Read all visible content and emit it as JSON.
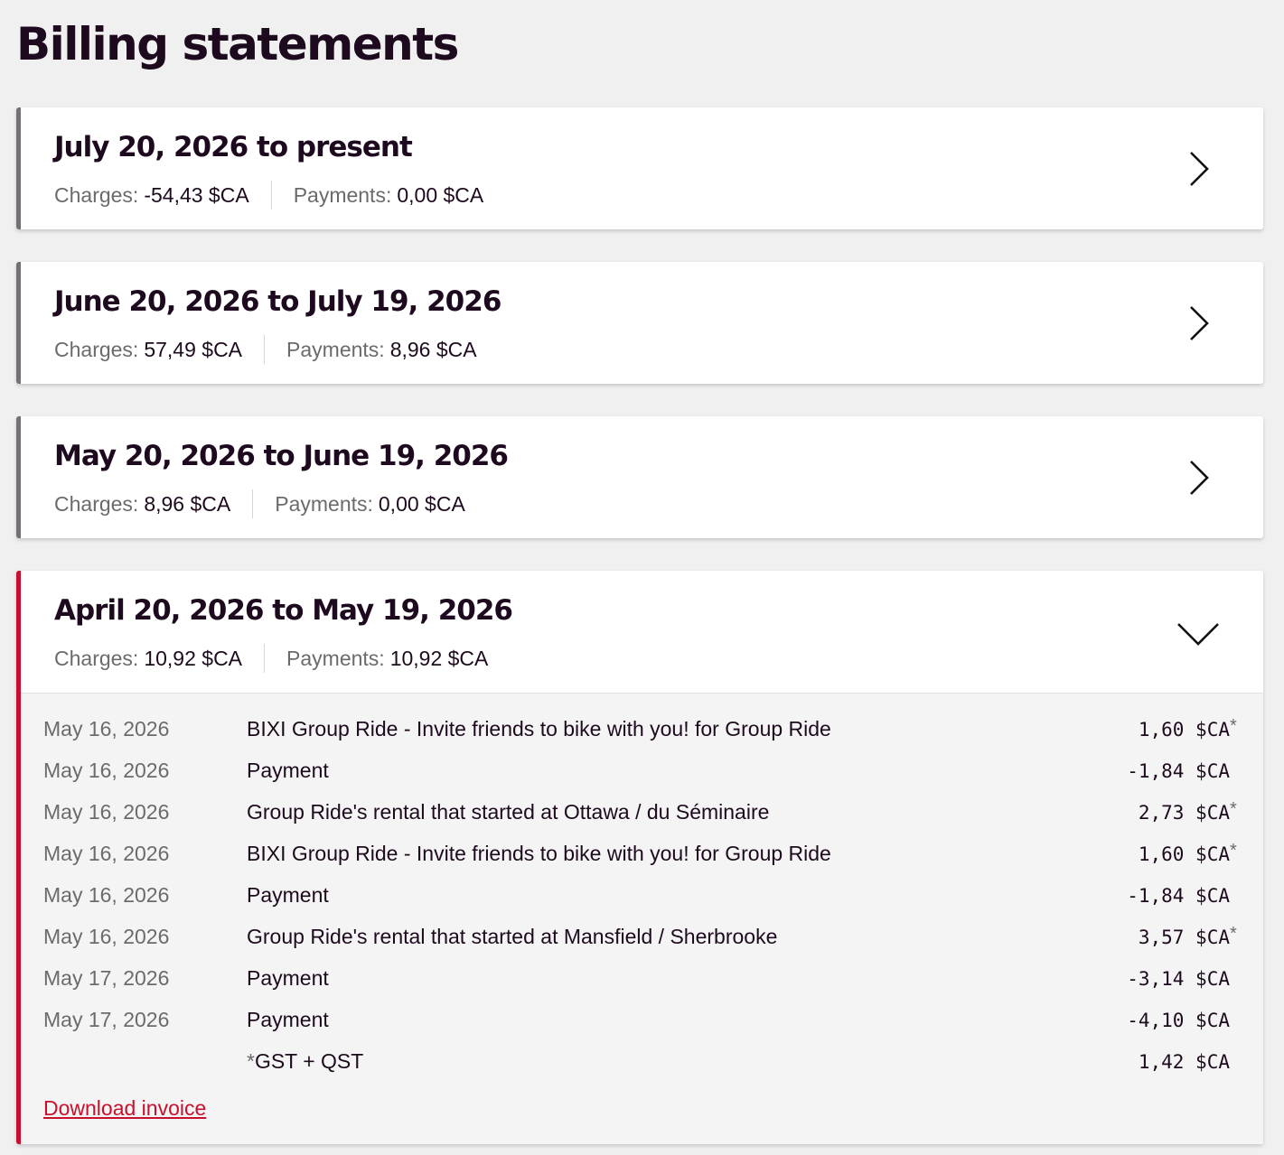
{
  "page": {
    "title": "Billing statements"
  },
  "labels": {
    "charges": "Charges:",
    "payments": "Payments:"
  },
  "statements": [
    {
      "period": "July 20, 2026 to present",
      "charges": "-54,43 $CA",
      "payments": "0,00 $CA",
      "expanded": false
    },
    {
      "period": "June 20, 2026 to July 19, 2026",
      "charges": "57,49 $CA",
      "payments": "8,96 $CA",
      "expanded": false
    },
    {
      "period": "May 20, 2026 to June 19, 2026",
      "charges": "8,96 $CA",
      "payments": "0,00 $CA",
      "expanded": false
    },
    {
      "period": "April 20, 2026 to May 19, 2026",
      "charges": "10,92 $CA",
      "payments": "10,92 $CA",
      "expanded": true,
      "transactions": [
        {
          "date": "May 16, 2026",
          "description": "BIXI Group Ride - Invite friends to bike with you! for Group Ride",
          "amount": "1,60 $CA",
          "taxable": true
        },
        {
          "date": "May 16, 2026",
          "description": "Payment",
          "amount": "-1,84 $CA",
          "taxable": false
        },
        {
          "date": "May 16, 2026",
          "description": "Group Ride's rental that started at Ottawa / du Séminaire",
          "amount": "2,73 $CA",
          "taxable": true
        },
        {
          "date": "May 16, 2026",
          "description": "BIXI Group Ride - Invite friends to bike with you! for Group Ride",
          "amount": "1,60 $CA",
          "taxable": true
        },
        {
          "date": "May 16, 2026",
          "description": "Payment",
          "amount": "-1,84 $CA",
          "taxable": false
        },
        {
          "date": "May 16, 2026",
          "description": "Group Ride's rental that started at Mansfield / Sherbrooke",
          "amount": "3,57 $CA",
          "taxable": true
        },
        {
          "date": "May 17, 2026",
          "description": "Payment",
          "amount": "-3,14 $CA",
          "taxable": false
        },
        {
          "date": "May 17, 2026",
          "description": "Payment",
          "amount": "-4,10 $CA",
          "taxable": false
        }
      ],
      "tax_row": {
        "mark": "*",
        "label": "GST + QST",
        "amount": "1,42 $CA"
      },
      "download_label": "Download invoice"
    }
  ],
  "icons": {
    "collapsed": "chevron-right-icon",
    "expanded": "chevron-down-icon"
  },
  "colors": {
    "accent": "#c8102e",
    "collapsed_border": "#757075",
    "background": "#f0f0f0"
  }
}
